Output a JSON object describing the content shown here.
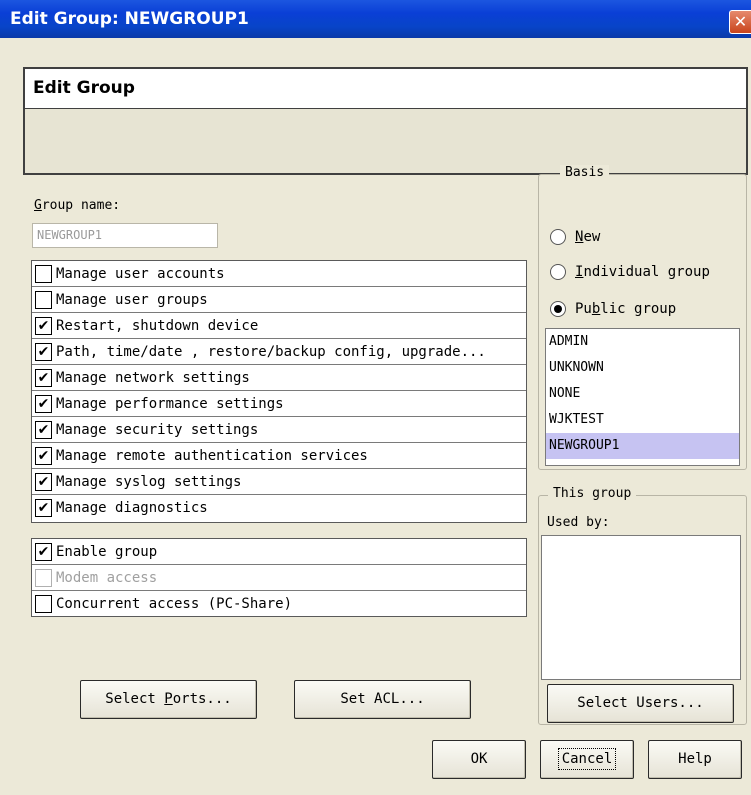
{
  "window": {
    "title": "Edit Group: NEWGROUP1",
    "close_glyph": "✕"
  },
  "header": {
    "title": "Edit Group"
  },
  "group_name": {
    "label_first": "G",
    "label_rest": "roup name:",
    "value": "NEWGROUP1"
  },
  "permissions": [
    {
      "label": "Manage user accounts",
      "checked": false
    },
    {
      "label": "Manage user groups",
      "checked": false
    },
    {
      "label": "Restart, shutdown device",
      "checked": true
    },
    {
      "label": "Path, time/date , restore/backup config, upgrade...",
      "checked": true
    },
    {
      "label": "Manage network settings",
      "checked": true
    },
    {
      "label": "Manage performance settings",
      "checked": true
    },
    {
      "label": "Manage security settings",
      "checked": true
    },
    {
      "label": "Manage remote authentication services",
      "checked": true
    },
    {
      "label": "Manage syslog settings",
      "checked": true
    },
    {
      "label": "Manage diagnostics",
      "checked": true
    }
  ],
  "options": [
    {
      "label": "Enable group",
      "checked": true,
      "disabled": false
    },
    {
      "label": "Modem access",
      "checked": false,
      "disabled": true
    },
    {
      "label": "Concurrent access (PC-Share)",
      "checked": false,
      "disabled": false
    }
  ],
  "basis": {
    "legend": "Basis",
    "new": {
      "u": "N",
      "rest": "ew",
      "selected": false
    },
    "individual": {
      "u": "I",
      "rest": "ndividual group",
      "selected": false
    },
    "public": {
      "pre": "Pu",
      "u": "b",
      "rest": "lic group",
      "selected": true
    },
    "groups": [
      "ADMIN",
      "UNKNOWN",
      "NONE",
      "WJKTEST",
      "NEWGROUP1"
    ],
    "selected_group": "NEWGROUP1"
  },
  "this_group": {
    "legend": "This group",
    "used_by_label": "Used by:",
    "users": []
  },
  "buttons": {
    "select_ports": {
      "pre": "Select ",
      "u": "P",
      "rest": "orts..."
    },
    "set_acl": "Set ACL...",
    "select_users": "Select Users...",
    "ok": "OK",
    "cancel": "Cancel",
    "help": "Help"
  }
}
